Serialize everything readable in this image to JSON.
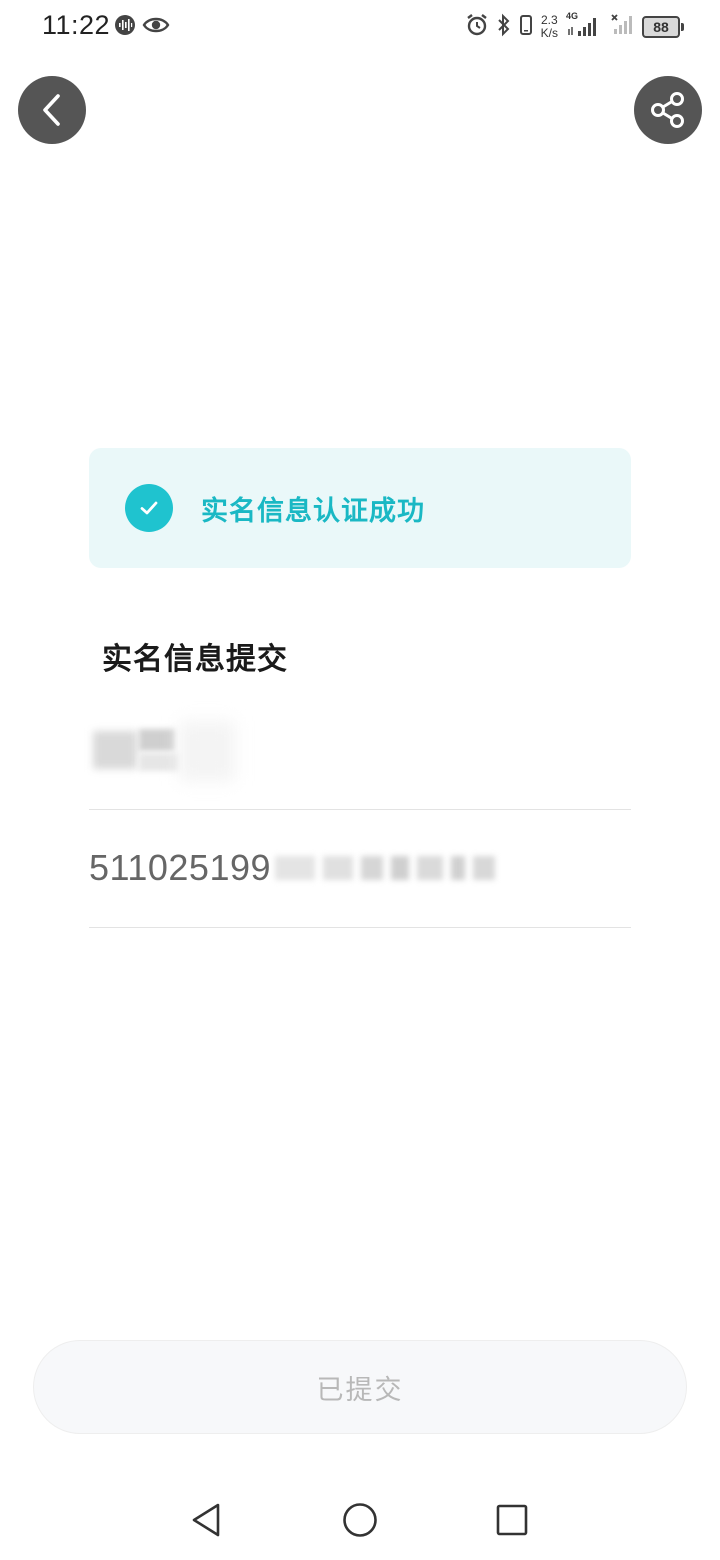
{
  "status_bar": {
    "time": "11:22",
    "net_speed_value": "2.3",
    "net_speed_unit": "K/s",
    "network_type": "4G",
    "battery": "88",
    "icons": [
      "voice-icon",
      "eye-icon",
      "alarm-icon",
      "bluetooth-icon",
      "vibrate-icon",
      "signal-icon",
      "no-signal-icon"
    ]
  },
  "header": {
    "back_icon": "chevron-left-icon",
    "share_icon": "share-icon"
  },
  "success": {
    "icon": "check-icon",
    "text": "实名信息认证成功",
    "accent_color": "#1fc3cf"
  },
  "section": {
    "title": "实名信息提交"
  },
  "fields": {
    "name_value_masked": true,
    "id_number_visible": "511025199"
  },
  "footer": {
    "submitted_label": "已提交"
  },
  "nav_bar": {
    "icons": [
      "nav-back-icon",
      "nav-home-icon",
      "nav-recent-icon"
    ]
  }
}
